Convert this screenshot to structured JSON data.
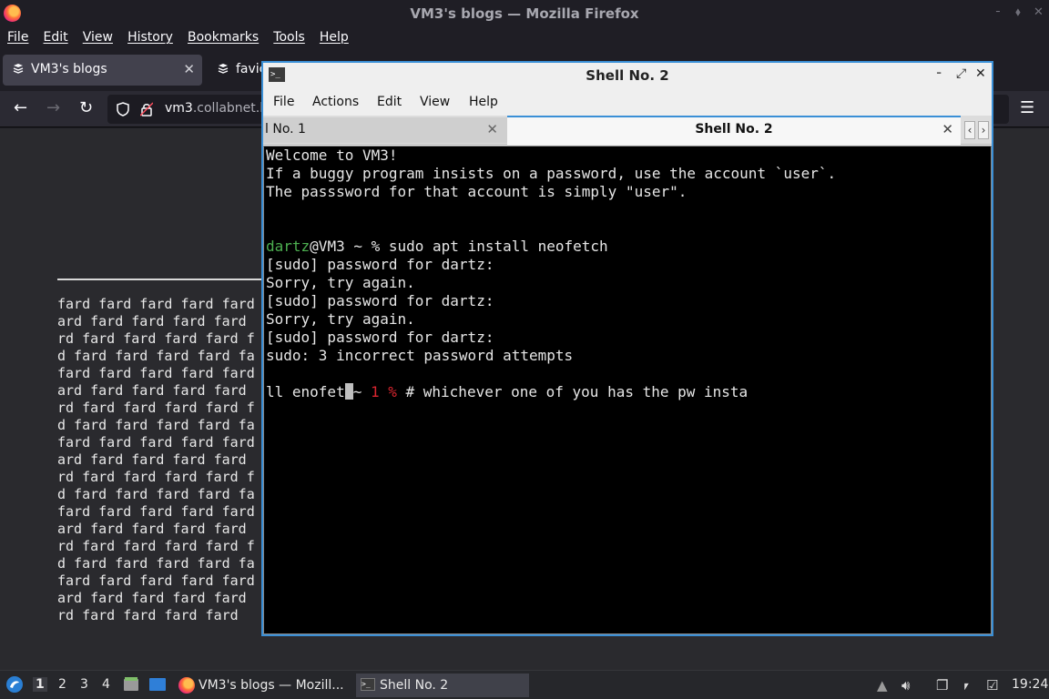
{
  "firefox": {
    "window_title": "VM3's blogs — Mozilla Firefox",
    "menu": [
      "File",
      "Edit",
      "View",
      "History",
      "Bookmarks",
      "Tools",
      "Help"
    ],
    "tabs": [
      {
        "label": "VM3's blogs",
        "active": true
      },
      {
        "label": "favic",
        "active": false
      }
    ],
    "url_domain": "vm3",
    "url_rest": ".collabnet.l",
    "page_lines": [
      "fard fard fard fard fard",
      "ard fard fard fard fard",
      "rd fard fard fard fard f",
      "d fard fard fard fard fa",
      "fard fard fard fard fard",
      "ard fard fard fard fard",
      "rd fard fard fard fard f",
      "d fard fard fard fard fa",
      "fard fard fard fard fard",
      "ard fard fard fard fard",
      "rd fard fard fard fard f",
      "d fard fard fard fard fa",
      "fard fard fard fard fard",
      "ard fard fard fard fard",
      "rd fard fard fard fard f",
      "d fard fard fard fard fa",
      "fard fard fard fard fard",
      "ard fard fard fard fard",
      "rd fard fard fard fard"
    ]
  },
  "terminal": {
    "title": "Shell No. 2",
    "menu": [
      "File",
      "Actions",
      "Edit",
      "View",
      "Help"
    ],
    "tab1": "l No. 1",
    "tab2": "Shell No. 2",
    "lines": {
      "l1": "Welcome to VM3!",
      "l2": "If a buggy program insists on a password, use the account `user`.",
      "l3": "The passsword for that account is simply \"user\".",
      "prompt_user": "dartz",
      "prompt_rest": "@VM3 ~ % sudo apt install neofetch",
      "l5": "[sudo] password for dartz:",
      "l6": "Sorry, try again.",
      "l7": "[sudo] password for dartz:",
      "l8": "Sorry, try again.",
      "l9": "[sudo] password for dartz:",
      "l10": "sudo: 3 incorrect password attempts",
      "cmd_pre": "ll enofet",
      "cmd_mid": "~ ",
      "cmd_status": "1 %",
      "cmd_post": " # whichever one of you has the pw insta"
    }
  },
  "taskbar": {
    "workspaces": [
      "1",
      "2",
      "3",
      "4"
    ],
    "tasks": [
      {
        "label": "VM3's blogs — Mozill...",
        "active": false
      },
      {
        "label": "Shell No. 2",
        "active": true
      }
    ],
    "clock": "19:24"
  }
}
